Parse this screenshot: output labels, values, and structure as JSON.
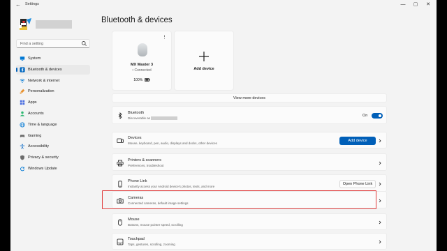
{
  "titlebar": {
    "back": "←",
    "title": "Settings",
    "minimize": "—",
    "maximize": "▢",
    "close": "✕"
  },
  "search": {
    "placeholder": "Find a setting"
  },
  "nav": [
    {
      "label": "System",
      "icon": "monitor-icon",
      "color": "#0078d4",
      "active": false
    },
    {
      "label": "Bluetooth & devices",
      "icon": "bluetooth-icon",
      "color": "#0067c0",
      "active": true
    },
    {
      "label": "Network & internet",
      "icon": "network-icon",
      "color": "#0078d4",
      "active": false
    },
    {
      "label": "Personalization",
      "icon": "brush-icon",
      "color": "#e8912d",
      "active": false
    },
    {
      "label": "Apps",
      "icon": "apps-icon",
      "color": "#4a6ee0",
      "active": false
    },
    {
      "label": "Accounts",
      "icon": "accounts-icon",
      "color": "#2eb872",
      "active": false
    },
    {
      "label": "Time & language",
      "icon": "globe-icon",
      "color": "#0078d4",
      "active": false
    },
    {
      "label": "Gaming",
      "icon": "gamepad-icon",
      "color": "#6b6b6b",
      "active": false
    },
    {
      "label": "Accessibility",
      "icon": "accessibility-icon",
      "color": "#1a73c9",
      "active": false
    },
    {
      "label": "Privacy & security",
      "icon": "shield-icon",
      "color": "#6b6b6b",
      "active": false
    },
    {
      "label": "Windows Update",
      "icon": "update-icon",
      "color": "#0078d4",
      "active": false
    }
  ],
  "main": {
    "title": "Bluetooth & devices",
    "device_card": {
      "name": "MX Master 3",
      "status": "• Connected",
      "battery": "100%",
      "more": "⋮"
    },
    "add_card": {
      "label": "Add device"
    },
    "view_more": "View more devices",
    "bluetooth": {
      "title": "Bluetooth",
      "subtitle": "Discoverable as",
      "toggle_label": "On",
      "toggle_on": true
    },
    "rows": [
      {
        "title": "Devices",
        "subtitle": "Mouse, keyboard, pen, audio, displays and docks, other devices",
        "icon": "devices-icon",
        "button": "Add device",
        "button_style": "primary"
      },
      {
        "title": "Printers & scanners",
        "subtitle": "Preferences, troubleshoot",
        "icon": "printer-icon"
      },
      {
        "title": "Phone Link",
        "subtitle": "Instantly access your Android device's photos, texts, and more",
        "icon": "phone-icon",
        "button": "Open Phone Link",
        "button_style": "secondary"
      },
      {
        "title": "Cameras",
        "subtitle": "Connected cameras, default image settings",
        "icon": "camera-icon",
        "highlighted": true
      },
      {
        "title": "Mouse",
        "subtitle": "Buttons, mouse pointer speed, scrolling",
        "icon": "mouse-icon"
      },
      {
        "title": "Touchpad",
        "subtitle": "Taps, gestures, scrolling, zooming",
        "icon": "touchpad-icon"
      }
    ]
  },
  "colors": {
    "accent": "#005fb8",
    "highlight": "#e03a3a"
  }
}
